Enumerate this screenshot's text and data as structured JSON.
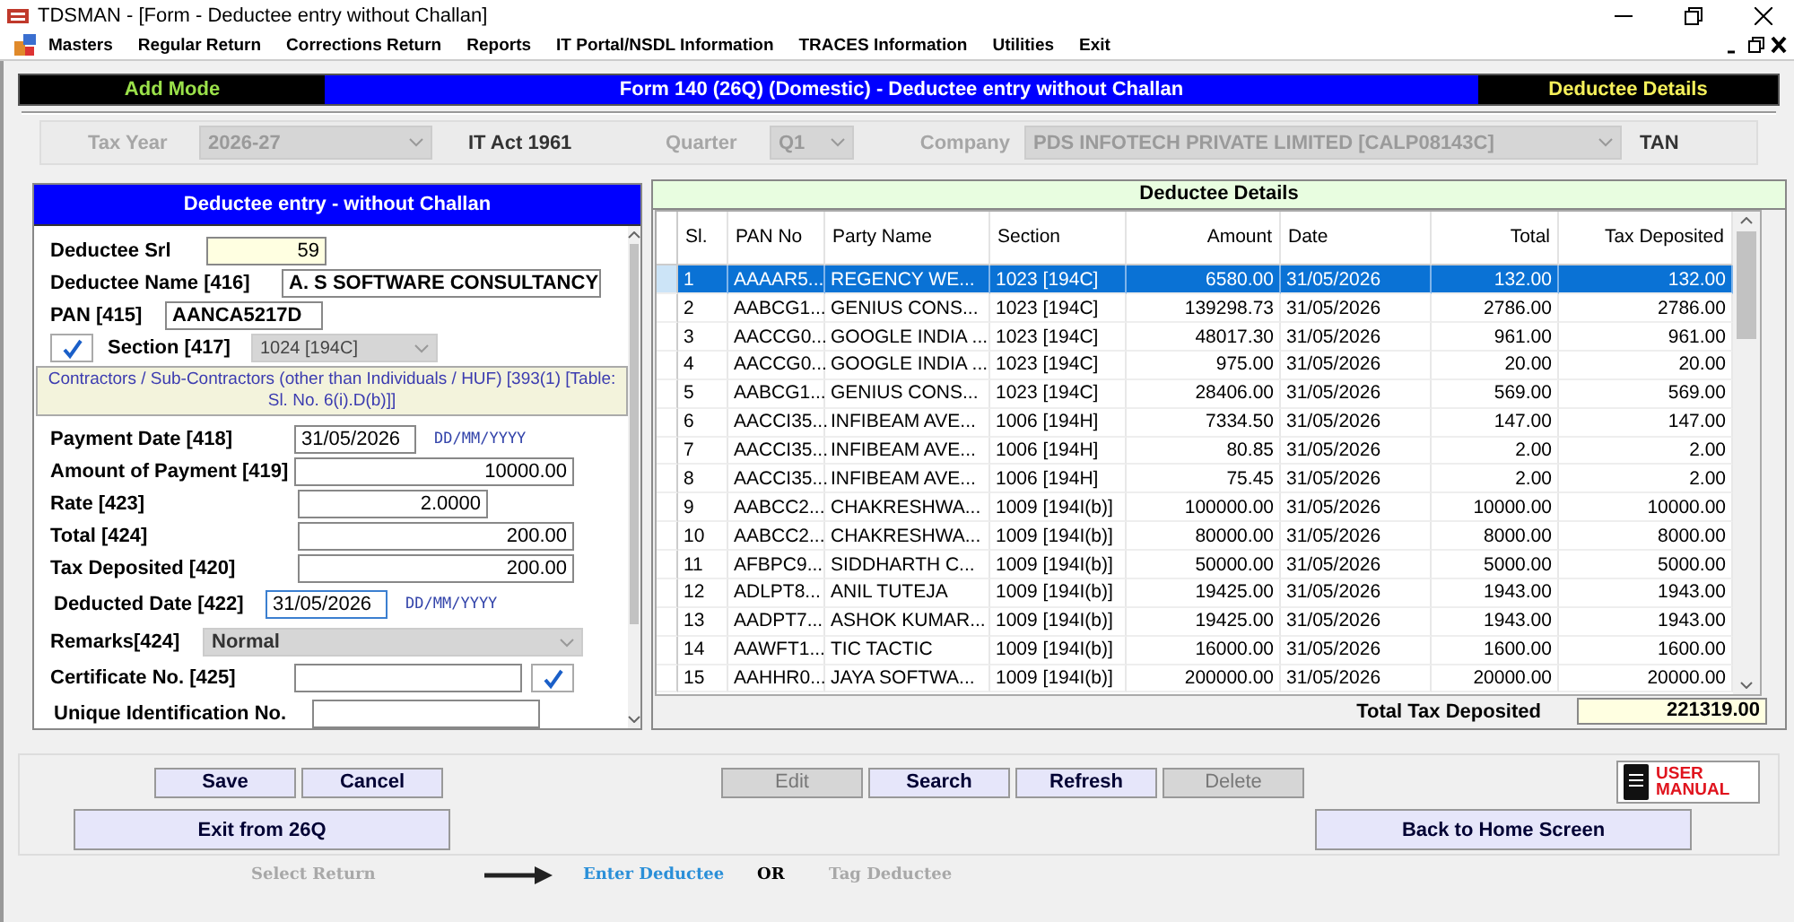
{
  "window": {
    "title": "TDSMAN - [Form   - Deductee entry without Challan]"
  },
  "menu": [
    "Masters",
    "Regular Return",
    "Corrections Return",
    "Reports",
    "IT Portal/NSDL Information",
    "TRACES Information",
    "Utilities",
    "Exit"
  ],
  "header": {
    "mode": "Add Mode",
    "title": "Form 140 (26Q) (Domestic) - Deductee entry without Challan",
    "section": "Deductee Details"
  },
  "filters": {
    "tax_year_label": "Tax Year",
    "tax_year": "2026-27",
    "act": "IT Act 1961",
    "quarter_label": "Quarter",
    "quarter": "Q1",
    "company_label": "Company",
    "company": "PDS INFOTECH PRIVATE LIMITED [CALP08143C]",
    "tan_label": "TAN",
    "disabled": true
  },
  "form": {
    "title": "Deductee entry - without Challan",
    "srl": {
      "label": "Deductee Srl",
      "value": "59"
    },
    "name": {
      "label": "Deductee Name [416]",
      "value": "A.  S SOFTWARE CONSULTANCY"
    },
    "pan": {
      "label": "PAN [415]",
      "value": "AANCA5217D"
    },
    "section": {
      "checked": true,
      "label": "Section [417]",
      "value": "1024 [194C]",
      "description": "Contractors / Sub-Contractors (other than Individuals / HUF) [393(1) [Table: Sl. No. 6(i).D(b)]]"
    },
    "payment_date": {
      "label": "Payment Date [418]",
      "value": "31/05/2026",
      "hint": "DD/MM/YYYY"
    },
    "amount": {
      "label": "Amount of Payment [419]",
      "value": "10000.00"
    },
    "rate": {
      "label": "Rate [423]",
      "value": "2.0000"
    },
    "total": {
      "label": "Total [424]",
      "value": "200.00"
    },
    "tax_deposited": {
      "label": "Tax Deposited [420]",
      "value": "200.00"
    },
    "deducted_date": {
      "label": "Deducted Date [422]",
      "value": "31/05/2026",
      "hint": "DD/MM/YYYY"
    },
    "remarks": {
      "label": "Remarks[424]",
      "value": "Normal"
    },
    "certificate": {
      "label": "Certificate No. [425]",
      "checked": true
    },
    "uid": {
      "label": "Unique Identification No."
    }
  },
  "table": {
    "title": "Deductee Details",
    "columns": [
      "Sl.",
      "PAN No",
      "Party Name",
      "Section",
      "Amount",
      "Date",
      "Total",
      "Tax Deposited"
    ],
    "rows": [
      {
        "selected": true,
        "cells": [
          "1",
          "AAAAR5...",
          "REGENCY WE...",
          "1023 [194C]",
          "6580.00",
          "31/05/2026",
          "132.00",
          "132.00"
        ]
      },
      {
        "selected": false,
        "cells": [
          "2",
          "AABCG1...",
          "GENIUS CONS...",
          "1023 [194C]",
          "139298.73",
          "31/05/2026",
          "2786.00",
          "2786.00"
        ]
      },
      {
        "selected": false,
        "cells": [
          "3",
          "AACCG0...",
          "GOOGLE INDIA ...",
          "1023 [194C]",
          "48017.30",
          "31/05/2026",
          "961.00",
          "961.00"
        ]
      },
      {
        "selected": false,
        "cells": [
          "4",
          "AACCG0...",
          "GOOGLE INDIA ...",
          "1023 [194C]",
          "975.00",
          "31/05/2026",
          "20.00",
          "20.00"
        ]
      },
      {
        "selected": false,
        "cells": [
          "5",
          "AABCG1...",
          "GENIUS CONS...",
          "1023 [194C]",
          "28406.00",
          "31/05/2026",
          "569.00",
          "569.00"
        ]
      },
      {
        "selected": false,
        "cells": [
          "6",
          "AACCI35...",
          "INFIBEAM AVE...",
          "1006 [194H]",
          "7334.50",
          "31/05/2026",
          "147.00",
          "147.00"
        ]
      },
      {
        "selected": false,
        "cells": [
          "7",
          "AACCI35...",
          "INFIBEAM AVE...",
          "1006 [194H]",
          "80.85",
          "31/05/2026",
          "2.00",
          "2.00"
        ]
      },
      {
        "selected": false,
        "cells": [
          "8",
          "AACCI35...",
          "INFIBEAM AVE...",
          "1006 [194H]",
          "75.45",
          "31/05/2026",
          "2.00",
          "2.00"
        ]
      },
      {
        "selected": false,
        "cells": [
          "9",
          "AABCC2...",
          "CHAKRESHWA...",
          "1009 [194I(b)]",
          "100000.00",
          "31/05/2026",
          "10000.00",
          "10000.00"
        ]
      },
      {
        "selected": false,
        "cells": [
          "10",
          "AABCC2...",
          "CHAKRESHWA...",
          "1009 [194I(b)]",
          "80000.00",
          "31/05/2026",
          "8000.00",
          "8000.00"
        ]
      },
      {
        "selected": false,
        "cells": [
          "11",
          "AFBPC9...",
          "SIDDHARTH C...",
          "1009 [194I(b)]",
          "50000.00",
          "31/05/2026",
          "5000.00",
          "5000.00"
        ]
      },
      {
        "selected": false,
        "cells": [
          "12",
          "ADLPT8...",
          "ANIL TUTEJA",
          "1009 [194I(b)]",
          "19425.00",
          "31/05/2026",
          "1943.00",
          "1943.00"
        ]
      },
      {
        "selected": false,
        "cells": [
          "13",
          "AADPT7...",
          "ASHOK KUMAR...",
          "1009 [194I(b)]",
          "19425.00",
          "31/05/2026",
          "1943.00",
          "1943.00"
        ]
      },
      {
        "selected": false,
        "cells": [
          "14",
          "AAWFT1...",
          "TIC TACTIC",
          "1009 [194I(b)]",
          "16000.00",
          "31/05/2026",
          "1600.00",
          "1600.00"
        ]
      },
      {
        "selected": false,
        "cells": [
          "15",
          "AAHHR0...",
          "JAYA SOFTWA...",
          "1009 [194I(b)]",
          "200000.00",
          "31/05/2026",
          "20000.00",
          "20000.00"
        ]
      }
    ],
    "total_label": "Total Tax Deposited",
    "total_value": "221319.00"
  },
  "buttons_row1": [
    {
      "label": "Save",
      "disabled": false
    },
    {
      "label": "Cancel",
      "disabled": false
    },
    {
      "label": "Edit",
      "disabled": true
    },
    {
      "label": "Search",
      "disabled": false
    },
    {
      "label": "Refresh",
      "disabled": false
    },
    {
      "label": "Delete",
      "disabled": true
    }
  ],
  "exit_button": "Exit from 26Q",
  "home_button": "Back to Home Screen",
  "manual_button": "USER MANUAL",
  "steps": [
    {
      "kind": "step",
      "label": "Select Return",
      "selected": false
    },
    {
      "kind": "arrow"
    },
    {
      "kind": "step",
      "label": "Enter Deductee",
      "selected": true
    },
    {
      "kind": "text",
      "label": "OR"
    },
    {
      "kind": "step",
      "label": "Tag Deductee",
      "selected": false
    }
  ]
}
